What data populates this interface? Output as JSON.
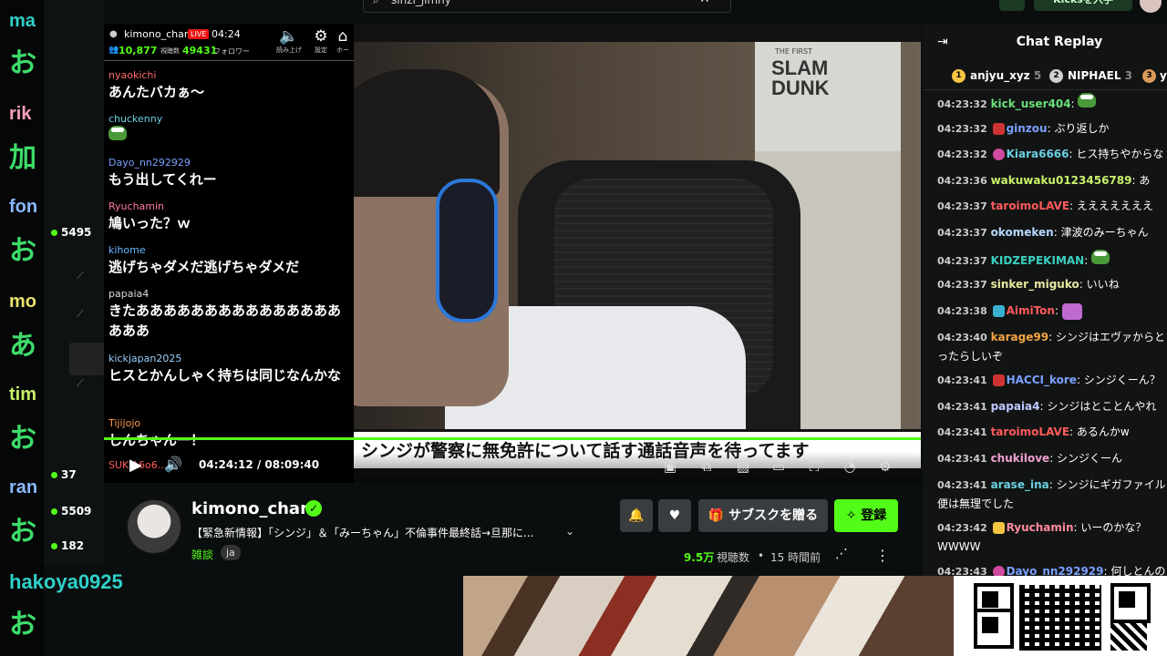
{
  "outer_column": {
    "entries": [
      {
        "name": "ma",
        "name_color": "#2fd0c8",
        "msg": "お",
        "msg_color": "#3ddc6a"
      },
      {
        "name": "rik",
        "name_color": "#f6a0c0",
        "msg": "加",
        "msg_color": "#3ddc6a"
      },
      {
        "name": "fon",
        "name_color": "#8ab8ff",
        "msg": "お",
        "msg_color": "#3ddc6a"
      },
      {
        "name": "mo",
        "name_color": "#e8e06a",
        "msg": "あ",
        "msg_color": "#3ddc6a"
      },
      {
        "name": "tim",
        "name_color": "#c8f06a",
        "msg": "お",
        "msg_color": "#3ddc6a"
      },
      {
        "name": "ran",
        "name_color": "#8ab8ff",
        "msg": "お",
        "msg_color": "#3ddc6a"
      }
    ],
    "hakoya_name": "hakoya0925",
    "hakoya_msg": "お"
  },
  "side_counts": [
    "5495",
    "37",
    "5509",
    "182"
  ],
  "overlay": {
    "channel": "kimono_chan",
    "live": "LIVE",
    "time": "04:24",
    "viewers": "10,877",
    "viewers_label": "視聴数",
    "followers": "49431",
    "followers_label": "フォロワー",
    "btn_read": "読み上げ",
    "btn_settings": "設定",
    "btn_home": "ホー",
    "messages": [
      {
        "user": "nyaokichi",
        "color": "#ff6a6a",
        "text": "あんたバカぁ～"
      },
      {
        "user": "chuckenny",
        "color": "#6ad0e0",
        "text": ""
      },
      {
        "user": "Dayo_nn292929",
        "color": "#7aa0ff",
        "text": "もう出してくれー"
      },
      {
        "user": "Ryuchamin",
        "color": "#ff7a9a",
        "text": "鳩いった？ｗ"
      },
      {
        "user": "kihome",
        "color": "#6ab8ff",
        "text": "逃げちゃダメだ逃げちゃダメだ"
      },
      {
        "user": "papaia4",
        "color": "#ddd",
        "text": "きたああああああああああああああああああ"
      },
      {
        "user": "kickjapan2025",
        "color": "#9ad0ff",
        "text": "ヒスとかんしゃく持ちは同じなんかな"
      },
      {
        "user": "Tijijojo",
        "color": "#ff9a4a",
        "text": "しんちゃんー！"
      },
      {
        "user": "SUKIA6o6...",
        "color": "#ff5a5a",
        "text": ""
      }
    ]
  },
  "video": {
    "poster_small": "THE FIRST",
    "poster_line1": "SLAM",
    "poster_line2": "DUNK",
    "subtitle": "シンジが警察に無免許について話す通話音声を待ってます",
    "timecode": "04:24:12 / 08:09:40"
  },
  "info": {
    "channel_name": "kimono_chan",
    "title": "【緊急新情報】「シンジ」＆「みーちゃん」不倫事件最終話→旦那に...",
    "category": "雑談",
    "language": "ja",
    "subscribe_label": "サブスクを贈る",
    "follow_label": "登録",
    "view_count": "9.5万",
    "view_label": "視聴数",
    "separator": "•",
    "ago": "15 時間前"
  },
  "replay": {
    "title": "Chat Replay",
    "top_gifters": [
      {
        "rank": "1",
        "name": "anjyu_xyz",
        "count": "5",
        "color": "#f5c542"
      },
      {
        "rank": "2",
        "name": "NIPHAEL",
        "count": "3",
        "color": "#d0d0d0"
      },
      {
        "rank": "3",
        "name": "y",
        "count": "",
        "color": "#d89a5a"
      }
    ],
    "rows": [
      {
        "time": "04:23:32",
        "user": "kick_user404",
        "color": "#6ae07a",
        "text": ""
      },
      {
        "time": "04:23:32",
        "user": "ginzou",
        "color": "#7aa0ff",
        "text": "ぶり返しか"
      },
      {
        "time": "04:23:32",
        "user": "Kiara6666",
        "color": "#6ad0e0",
        "text": "ヒス持ちやからな"
      },
      {
        "time": "04:23:36",
        "user": "wakuwaku0123456789",
        "color": "#c8f06a",
        "text": "あ"
      },
      {
        "time": "04:23:37",
        "user": "taroimoLAVE",
        "color": "#ff5a5a",
        "text": "えええええええ"
      },
      {
        "time": "04:23:37",
        "user": "okomeken",
        "color": "#b8d8ff",
        "text": "津波のみーちゃん"
      },
      {
        "time": "04:23:37",
        "user": "KIDZEPEKIMAN",
        "color": "#3ad0c0",
        "text": ""
      },
      {
        "time": "04:23:37",
        "user": "sinker_miguko",
        "color": "#e8e8a0",
        "text": "いいね"
      },
      {
        "time": "04:23:38",
        "user": "AimiTon",
        "color": "#ff5a5a",
        "text": ""
      },
      {
        "time": "04:23:40",
        "user": "karage99",
        "color": "#f5a442",
        "text": "シンジはエヴァからとったらしいぞ"
      },
      {
        "time": "04:23:41",
        "user": "HACCI_kore",
        "color": "#7aa0ff",
        "text": "シンジくーん？"
      },
      {
        "time": "04:23:41",
        "user": "papaia4",
        "color": "#c0c8ff",
        "text": "シンジはとことんやれ"
      },
      {
        "time": "04:23:41",
        "user": "taroimoLAVE",
        "color": "#ff5a5a",
        "text": "あるんかw"
      },
      {
        "time": "04:23:41",
        "user": "chukilove",
        "color": "#f0a0d0",
        "text": "シンジくーん"
      },
      {
        "time": "04:23:41",
        "user": "arase_ina",
        "color": "#6ad0e0",
        "text": "シンジにギガファイル便は無理でした"
      },
      {
        "time": "04:23:42",
        "user": "Ryuchamin",
        "color": "#ff8aa0",
        "text": "いーのかな？WWWW"
      },
      {
        "time": "04:23:43",
        "user": "Dayo_nn292929",
        "color": "#7aa0ff",
        "text": "何しとんのや"
      }
    ]
  },
  "search": {
    "value": "sinzi_jimny"
  },
  "top_right": {
    "kicks_label": "Kicksを入手"
  }
}
